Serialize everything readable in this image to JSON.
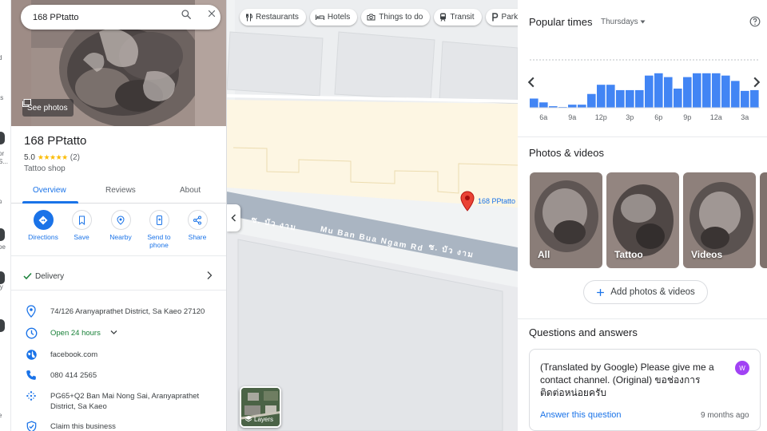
{
  "left_strip": {
    "fragments": [
      "d",
      "ts",
      "pr",
      "S...",
      "ว",
      "oe",
      "ly",
      "e"
    ]
  },
  "search": {
    "value": "168 PPtatto"
  },
  "hero": {
    "see_photos_label": "See photos"
  },
  "place": {
    "name": "168 PPtatto",
    "rating": "5.0",
    "stars": "★★★★★",
    "review_count": "(2)",
    "category": "Tattoo shop"
  },
  "tabs": [
    {
      "label": "Overview",
      "active": true
    },
    {
      "label": "Reviews",
      "active": false
    },
    {
      "label": "About",
      "active": false
    }
  ],
  "actions": [
    {
      "label": "Directions",
      "icon": "directions-icon"
    },
    {
      "label": "Save",
      "icon": "bookmark-icon"
    },
    {
      "label": "Nearby",
      "icon": "nearby-icon"
    },
    {
      "label": "Send to phone",
      "icon": "send-to-phone-icon"
    },
    {
      "label": "Share",
      "icon": "share-icon"
    }
  ],
  "delivery": {
    "label": "Delivery"
  },
  "info": {
    "address": "74/126 Aranyaprathet District, Sa Kaeo 27120",
    "hours": "Open 24 hours",
    "website": "facebook.com",
    "phone": "080 414 2565",
    "plus_code": "PG65+Q2 Ban Mai Nong Sai, Aranyaprathet District, Sa Kaeo",
    "claim": "Claim this business"
  },
  "map": {
    "chips": [
      {
        "label": "Restaurants",
        "icon": "fork-knife-icon"
      },
      {
        "label": "Hotels",
        "icon": "bed-icon"
      },
      {
        "label": "Things to do",
        "icon": "camera-icon"
      },
      {
        "label": "Transit",
        "icon": "train-icon"
      },
      {
        "label": "Parking",
        "icon": "parking-icon"
      }
    ],
    "pin_label": "168 PPtatto",
    "road_label_main": "Mu Ban Bua Ngam Rd",
    "road_label_thai_1": "ซ. บัว งาม",
    "road_label_thai_2": "ซ. บัว งาม",
    "layers_label": "Layers"
  },
  "popular_times": {
    "title": "Popular times",
    "day": "Thursdays",
    "tick_labels": [
      "6a",
      "9a",
      "12p",
      "3p",
      "6p",
      "9p",
      "12a",
      "3a"
    ],
    "hourly_busyness": [
      12,
      7,
      2,
      0,
      4,
      4,
      18,
      30,
      30,
      23,
      23,
      23,
      42,
      45,
      40,
      25,
      40,
      45,
      45,
      45,
      42,
      35,
      22,
      23
    ],
    "bar_color": "#4285f4"
  },
  "photos": {
    "title": "Photos & videos",
    "tiles": [
      "All",
      "Tattoo",
      "Videos"
    ],
    "add_label": "Add photos & videos"
  },
  "qa": {
    "title": "Questions and answers",
    "question": "(Translated by Google) Please give me a contact channel. (Original) ขอช่องการติดต่อหน่อยครับ",
    "avatar_letter": "W",
    "answer_label": "Answer this question",
    "time": "9 months ago"
  }
}
